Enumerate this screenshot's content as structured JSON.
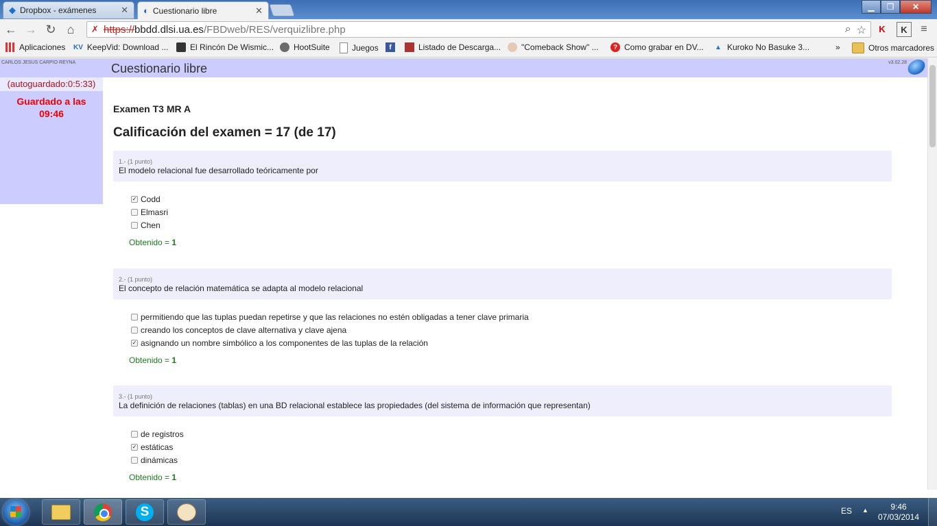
{
  "browser": {
    "tabs": [
      {
        "label": "Dropbox - exámenes",
        "active": false
      },
      {
        "label": "Cuestionario libre",
        "active": true
      }
    ],
    "url": {
      "scheme": "https://",
      "host": "bbdd.dlsi.ua.es",
      "path": "/FBDweb/RES/verquizlibre.php"
    },
    "bookmarks": [
      {
        "label": "Aplicaciones",
        "icon": "apps-icon"
      },
      {
        "label": "KeepVid: Download ...",
        "icon": "kv-icon",
        "prefix": "KV"
      },
      {
        "label": "El Rincón De Wismic...",
        "icon": "site-icon"
      },
      {
        "label": "HootSuite",
        "icon": "owl-icon"
      },
      {
        "label": "Juegos",
        "icon": "page-icon"
      },
      {
        "label": "",
        "icon": "facebook-icon"
      },
      {
        "label": "Listado de Descarga...",
        "icon": "flame-icon"
      },
      {
        "label": "\"Comeback Show\" ...",
        "icon": "doll-icon"
      },
      {
        "label": "Como grabar en DV...",
        "icon": "question-icon"
      },
      {
        "label": "Kuroko No Basuke 3...",
        "icon": "triangle-icon"
      }
    ],
    "more_label": "»",
    "other_bookmarks": "Otros marcadores"
  },
  "page": {
    "user_name": "CARLOS JESUS CARPIO REYNA",
    "title": "Cuestionario libre",
    "version": "v3.02.28",
    "sidebar": {
      "autosave": "(autoguardado:0:5:33)",
      "saved_line1": "Guardado a las",
      "saved_line2": "09:46"
    },
    "exam_name": "Examen T3 MR A",
    "grade": "Calificación del examen = 17 (de 17)",
    "questions": [
      {
        "num": "1.- (1 punto)",
        "text": "El modelo relacional fue desarrollado teóricamente por",
        "options": [
          {
            "label": "Codd",
            "checked": true
          },
          {
            "label": "Elmasri",
            "checked": false
          },
          {
            "label": "Chen",
            "checked": false
          }
        ],
        "score_label": "Obtenido = ",
        "score": "1"
      },
      {
        "num": "2.- (1 punto)",
        "text": "El concepto de relación matemática se adapta al modelo relacional",
        "options": [
          {
            "label": "permitiendo que las tuplas puedan repetirse y que las relaciones no estén obligadas a tener clave primaria",
            "checked": false
          },
          {
            "label": "creando los conceptos de clave alternativa y clave ajena",
            "checked": false
          },
          {
            "label": "asignando un nombre simbólico a los componentes de las tuplas de la relación",
            "checked": true
          }
        ],
        "score_label": "Obtenido = ",
        "score": "1"
      },
      {
        "num": "3.- (1 punto)",
        "text": "La definición de relaciones (tablas) en una BD relacional establece las propiedades (del sistema de información que representan)",
        "options": [
          {
            "label": "de registros",
            "checked": false
          },
          {
            "label": "estáticas",
            "checked": true
          },
          {
            "label": "dinámicas",
            "checked": false
          }
        ],
        "score_label": "Obtenido = ",
        "score": "1"
      }
    ]
  },
  "taskbar": {
    "language": "ES",
    "time": "9:46",
    "date": "07/03/2014"
  },
  "colors": {
    "header_band": "#ccccff",
    "question_band": "#eeeefc",
    "saved_red": "#ee0000",
    "score_green": "#1a7a1a"
  }
}
